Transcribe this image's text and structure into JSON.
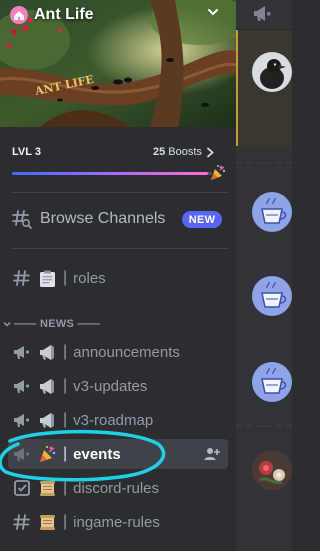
{
  "server": {
    "name": "Ant Life"
  },
  "banner": {
    "art_text": "ANT LIFE"
  },
  "boost": {
    "level_label": "LVL 3",
    "count": "25",
    "count_suffix": " Boosts",
    "progress_fraction": 0.98
  },
  "browse": {
    "label": "Browse Channels",
    "badge": "NEW"
  },
  "channels_top": [
    {
      "emoji": "clipboard-icon",
      "sep": "|",
      "name": "roles",
      "type": "text"
    }
  ],
  "category": {
    "label": "—— NEWS ——"
  },
  "channels_news": [
    {
      "emoji": "loudspeaker-icon",
      "sep": "|",
      "name": "announcements",
      "type": "announcement"
    },
    {
      "emoji": "loudspeaker-icon",
      "sep": "|",
      "name": "v3-updates",
      "type": "announcement"
    },
    {
      "emoji": "loudspeaker-icon",
      "sep": "|",
      "name": "v3-roadmap",
      "type": "announcement"
    },
    {
      "emoji": "party-popper-icon",
      "sep": "|",
      "name": "events",
      "type": "announcement",
      "selected": true
    },
    {
      "emoji": "scroll-icon",
      "sep": "|",
      "name": "discord-rules",
      "type": "rules"
    },
    {
      "emoji": "scroll-icon",
      "sep": "|",
      "name": "ingame-rules",
      "type": "text"
    }
  ],
  "colors": {
    "sidebar_bg": "#2b2d31",
    "chat_bg": "#313338",
    "brand": "#5865f2",
    "highlight_ring": "#1fd1e6",
    "selected_bg": "#404249",
    "muted_text": "#949ba4"
  }
}
